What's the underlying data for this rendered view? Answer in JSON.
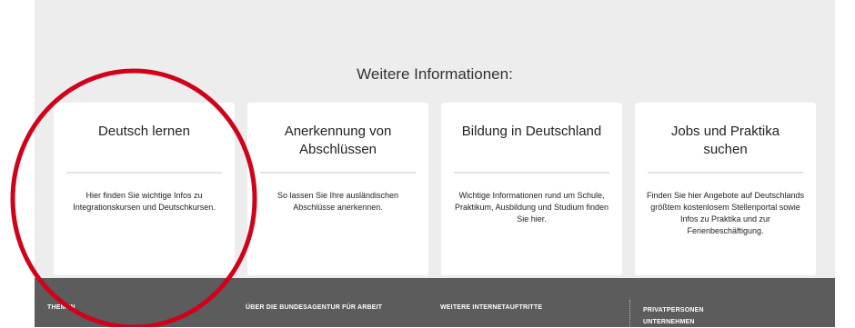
{
  "section": {
    "title": "Weitere Informationen:"
  },
  "cards": [
    {
      "title": "Deutsch lernen",
      "text": "Hier finden Sie wichtige Infos zu Integrationskursen und Deutschkursen."
    },
    {
      "title": "Anerkennung von Abschlüssen",
      "text": "So lassen Sie Ihre ausländischen Abschlüsse anerkennen."
    },
    {
      "title": "Bildung in Deutschland",
      "text": "Wichtige Informationen rund um Schule, Praktikum, Ausbildung und Studium finden Sie hier."
    },
    {
      "title": "Jobs und Praktika suchen",
      "text": "Finden Sie hier Angebote auf Deutschlands größtem kostenlosem Stellenportal sowie Infos zu Praktika und zur Ferienbeschäftigung."
    }
  ],
  "footer": {
    "col1": "THEMEN",
    "col2": "ÜBER DIE BUNDESAGENTUR FÜR ARBEIT",
    "col3": "WEITERE INTERNETAUFTRITTE",
    "audience": [
      "PRIVATPERSONEN",
      "UNTERNEHMEN"
    ]
  },
  "colors": {
    "page_background": "#ededed",
    "footer_background": "#5c5c5c",
    "annotation_circle": "#d0021b"
  }
}
